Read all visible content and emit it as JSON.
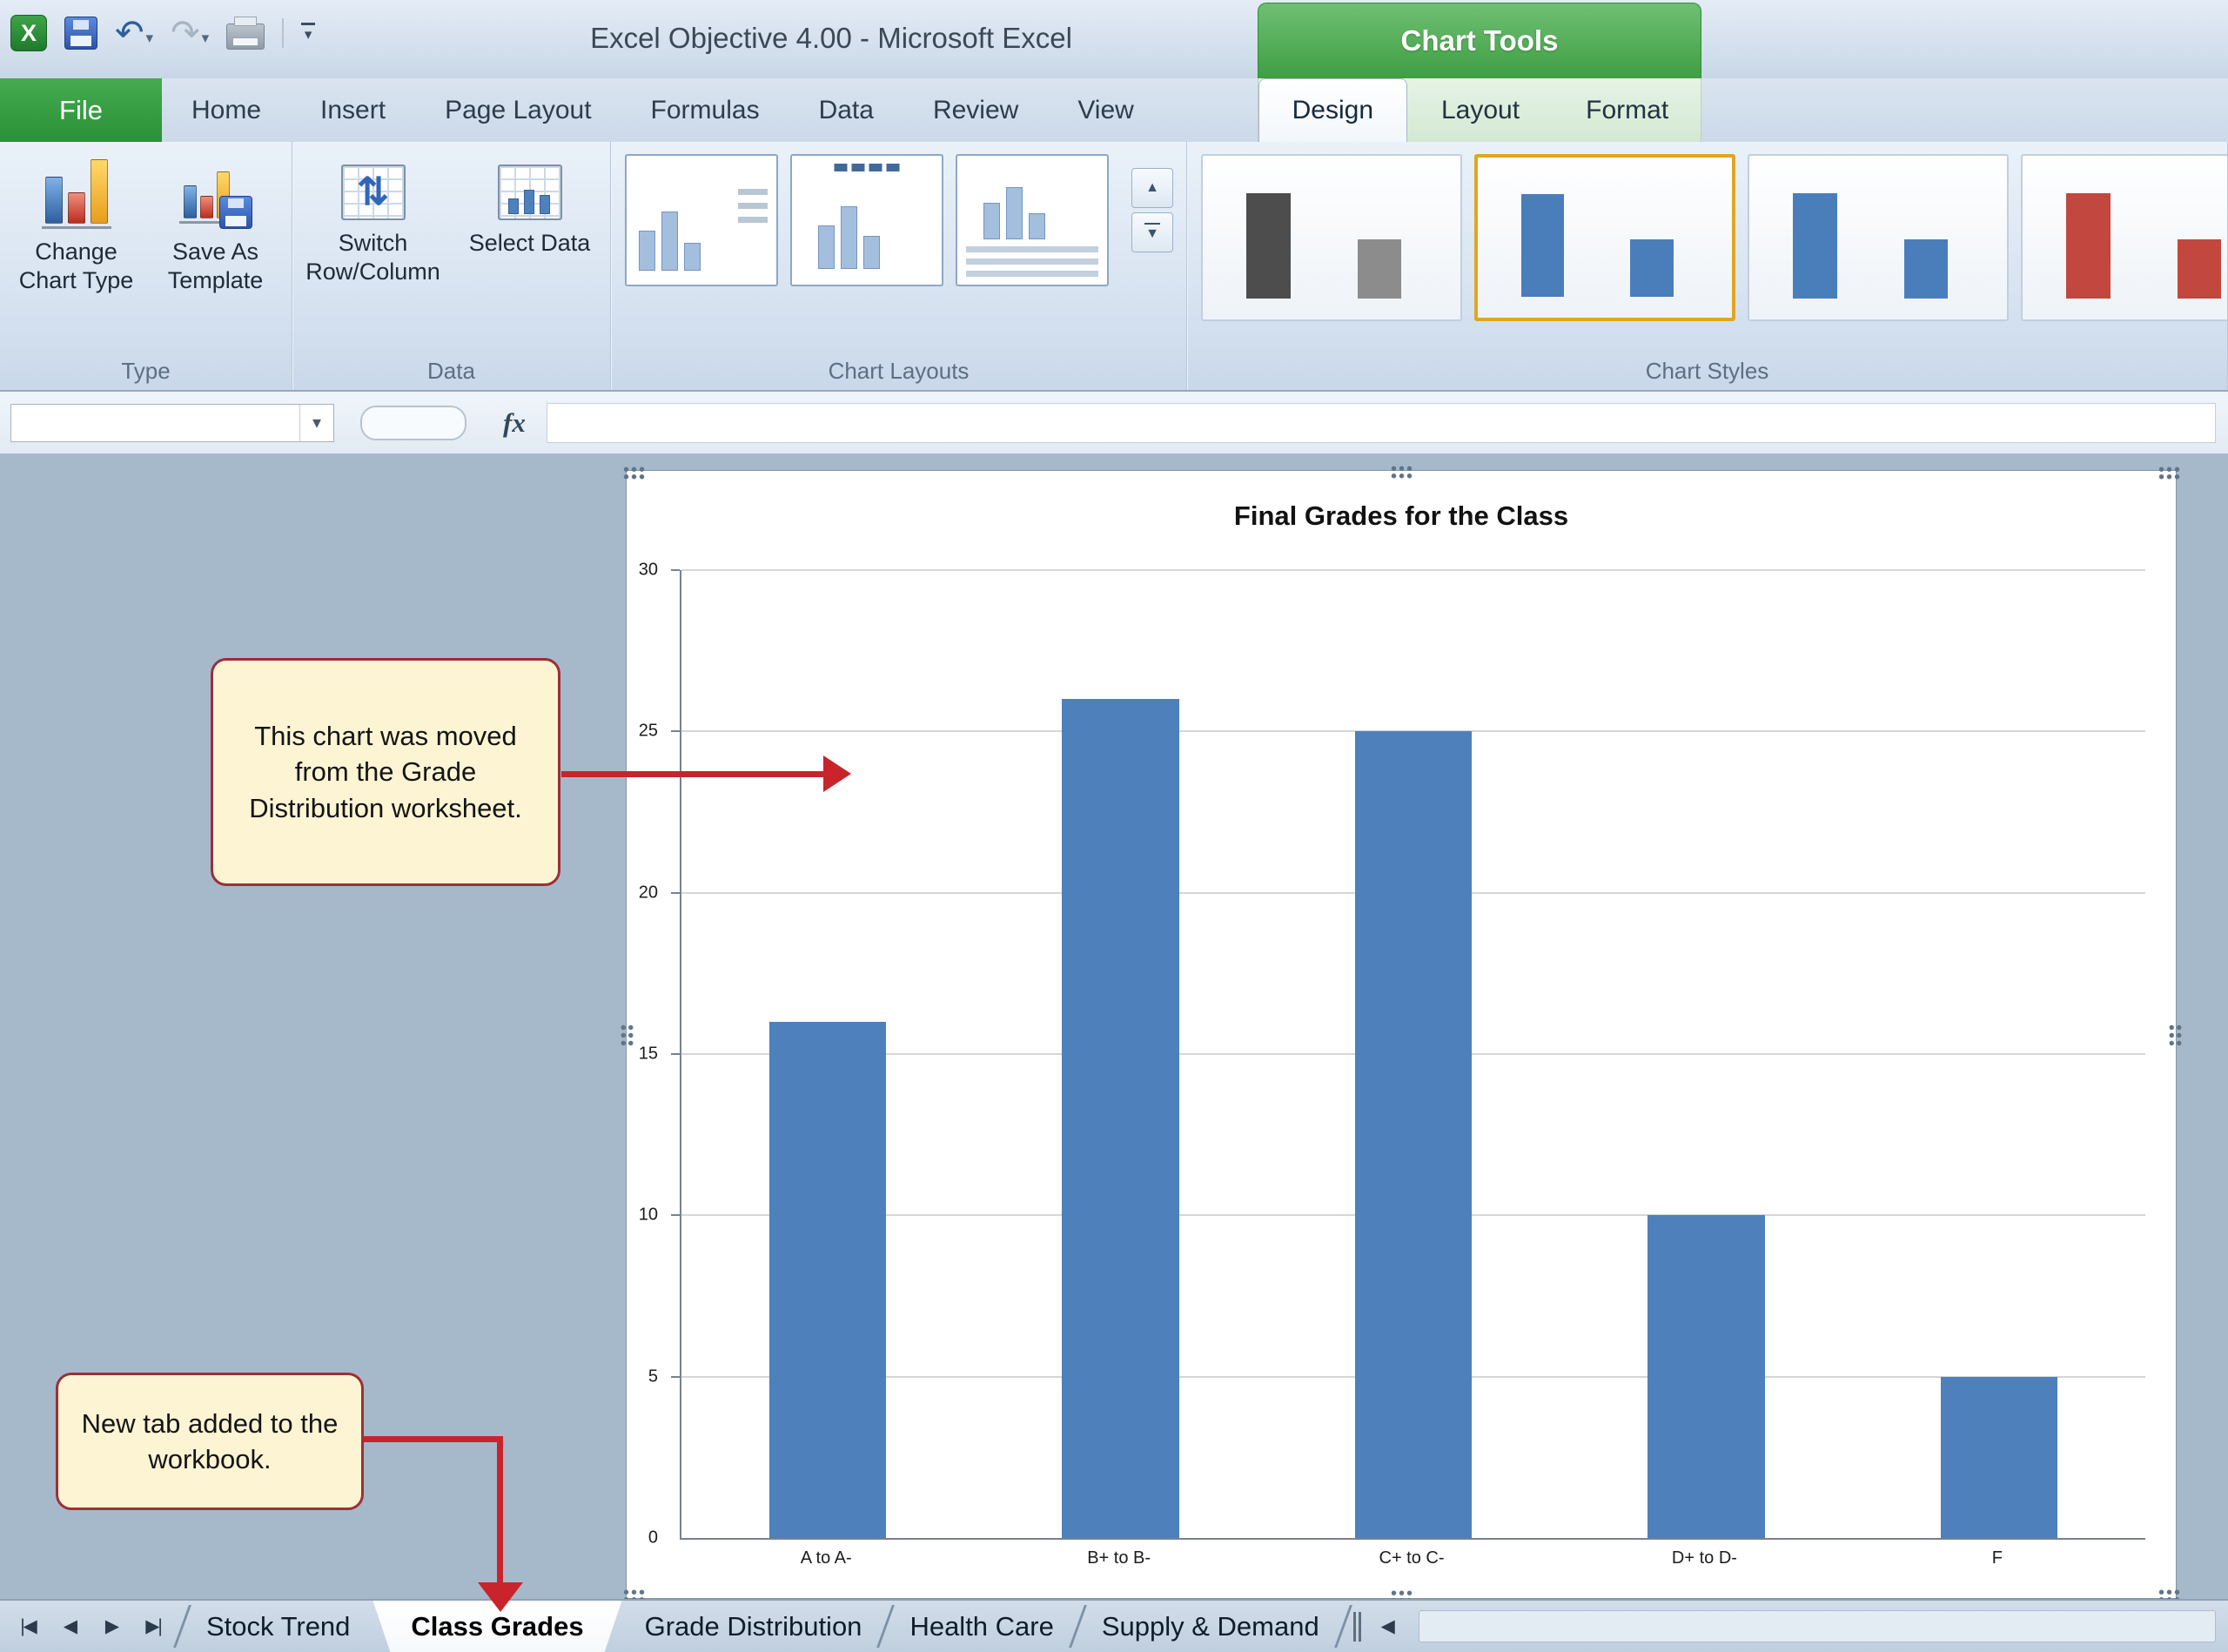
{
  "window": {
    "title": "Excel Objective 4.00 - Microsoft Excel",
    "contextual_group": "Chart Tools"
  },
  "colors": {
    "chart_tools_green": "#3f9e44",
    "file_tab_green": "#2a9138",
    "callout_bg": "#fdf4d3",
    "callout_border": "#9c2f38",
    "arrow_red": "#c9242b",
    "bar_blue": "#4e80bc",
    "style_selected": "#dfa621",
    "worksheet_bg": "#a6b9cb"
  },
  "icons": {
    "excel_logo": "X",
    "undo": "↶",
    "redo": "↷",
    "dropdown_caret": "▾",
    "switch_arrows": "⇅",
    "scroll_up": "▲",
    "scroll_more": "▼",
    "nav_first": "|◀",
    "nav_prev": "◀",
    "nav_next": "▶",
    "nav_last": "▶|",
    "tab_scroll_left": "◀"
  },
  "ribbon": {
    "tabs": [
      "File",
      "Home",
      "Insert",
      "Page Layout",
      "Formulas",
      "Data",
      "Review",
      "View"
    ],
    "contextual_tabs": [
      "Design",
      "Layout",
      "Format"
    ],
    "active_tab": "Design",
    "groups": {
      "type": {
        "label": "Type",
        "buttons": [
          "Change Chart Type",
          "Save As Template"
        ]
      },
      "data": {
        "label": "Data",
        "buttons": [
          "Switch Row/Column",
          "Select Data"
        ]
      },
      "layouts": {
        "label": "Chart Layouts"
      },
      "styles": {
        "label": "Chart Styles",
        "items": [
          {
            "name": "style-dark-gray",
            "bar1": "#4d4d4d",
            "bar2": "#8c8c8c",
            "selected": false
          },
          {
            "name": "style-blue",
            "bar1": "#4a7ebb",
            "bar2": "#4a7ebb",
            "selected": true
          },
          {
            "name": "style-blue-beveled",
            "bar1": "#4a7ebb",
            "bar2": "#4a7ebb",
            "selected": false
          },
          {
            "name": "style-red",
            "bar1": "#c2473f",
            "bar2": "#c2473f",
            "selected": false
          }
        ]
      }
    }
  },
  "formula_bar": {
    "name_box_value": "",
    "fx_label": "fx"
  },
  "chart_data": {
    "type": "bar",
    "title": "Final Grades for the Class",
    "categories": [
      "A to A-",
      "B+ to B-",
      "C+ to C-",
      "D+ to D-",
      "F"
    ],
    "values": [
      16,
      26,
      25,
      10,
      5
    ],
    "xlabel": "",
    "ylabel": "",
    "ylim": [
      0,
      30
    ],
    "yticks": [
      0,
      5,
      10,
      15,
      20,
      25,
      30
    ],
    "grid": true,
    "legend": "none",
    "bar_color": "#4e80bc"
  },
  "callouts": {
    "chart_moved": {
      "text": "This chart was moved from the Grade Distribution worksheet."
    },
    "new_tab": {
      "text": "New tab added to the workbook."
    }
  },
  "sheet_tabs": {
    "tabs": [
      "Stock Trend",
      "Class Grades",
      "Grade Distribution",
      "Health Care",
      "Supply & Demand"
    ],
    "active": "Class Grades"
  }
}
